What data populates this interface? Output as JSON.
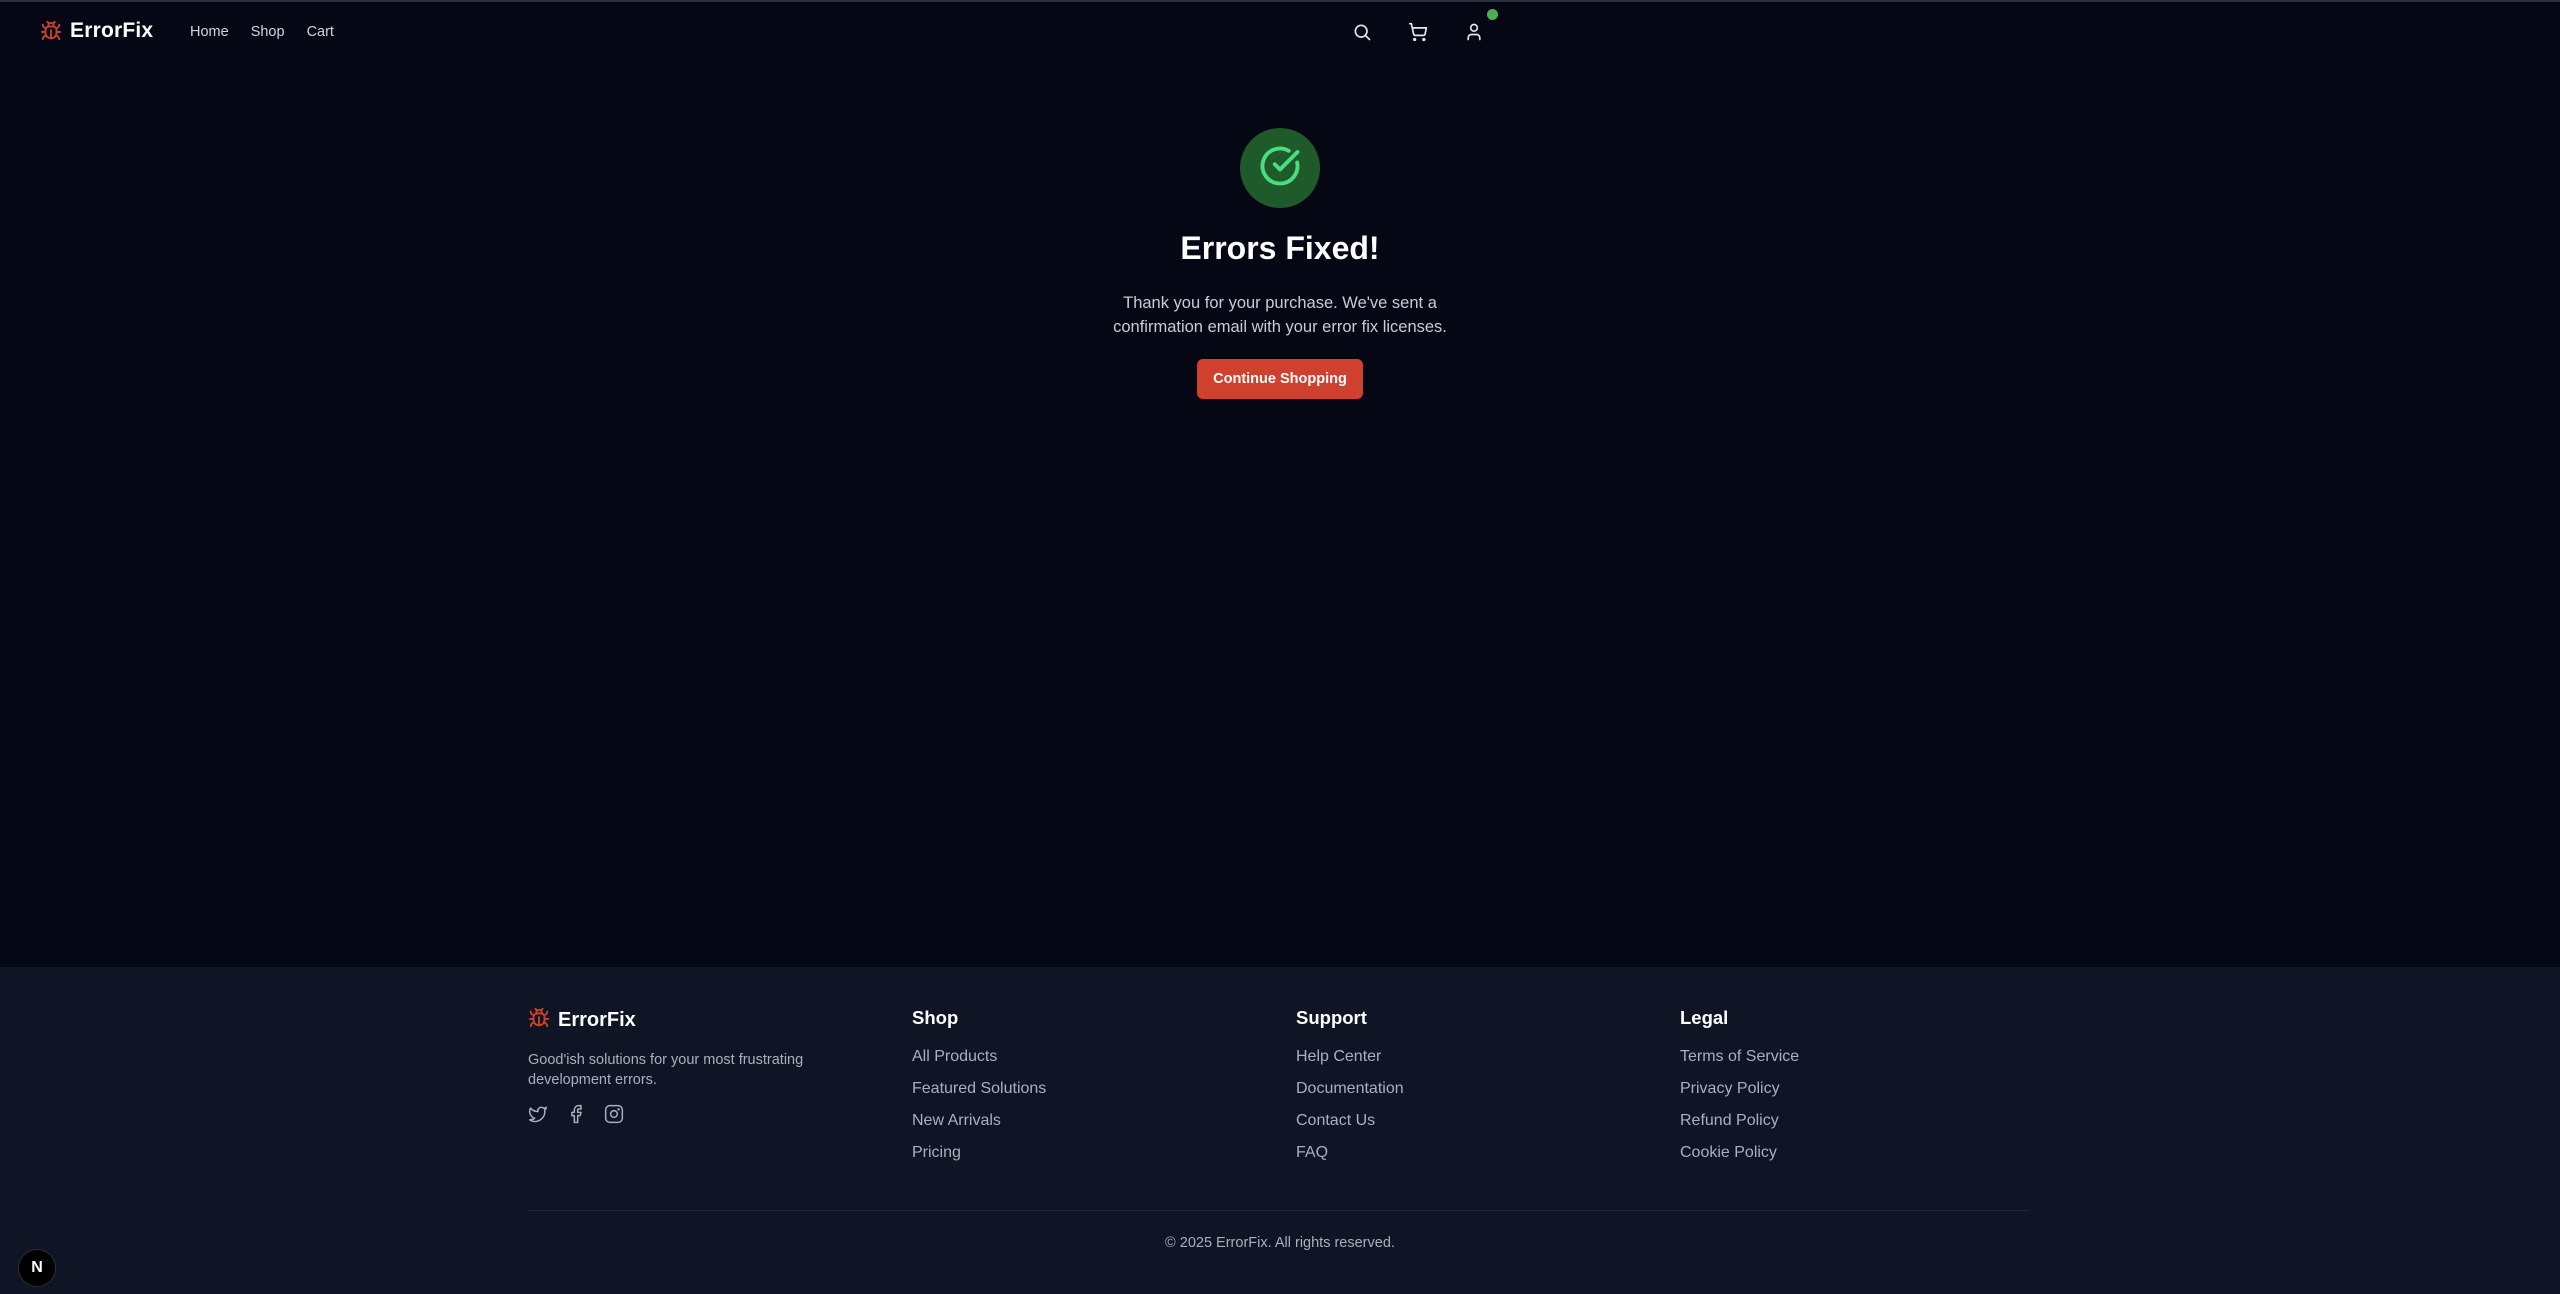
{
  "colors": {
    "accent": "#d0412d",
    "success_bg": "#1f5a2a",
    "success_icon": "#4ade80",
    "status_dot": "#4caf50",
    "background": "#050814",
    "footer_bg": "#0f1524"
  },
  "header": {
    "brand_icon": "bug-icon",
    "brand_name": "ErrorFix",
    "nav": [
      "Home",
      "Shop",
      "Cart"
    ],
    "icons": [
      "search-icon",
      "cart-icon",
      "user-icon"
    ]
  },
  "main": {
    "icon": "check-circle-icon",
    "title": "Errors Fixed!",
    "message": "Thank you for your purchase. We've sent a confirmation email with your error fix licenses.",
    "button_label": "Continue Shopping"
  },
  "footer": {
    "brand_name": "ErrorFix",
    "tagline": "Good'ish solutions for your most frustrating development errors.",
    "social_icons": [
      "twitter-icon",
      "facebook-icon",
      "instagram-icon"
    ],
    "columns": [
      {
        "title": "Shop",
        "links": [
          "All Products",
          "Featured Solutions",
          "New Arrivals",
          "Pricing"
        ]
      },
      {
        "title": "Support",
        "links": [
          "Help Center",
          "Documentation",
          "Contact Us",
          "FAQ"
        ]
      },
      {
        "title": "Legal",
        "links": [
          "Terms of Service",
          "Privacy Policy",
          "Refund Policy",
          "Cookie Policy"
        ]
      }
    ],
    "copyright": "© 2025 ErrorFix. All rights reserved."
  },
  "dev_badge": "N"
}
